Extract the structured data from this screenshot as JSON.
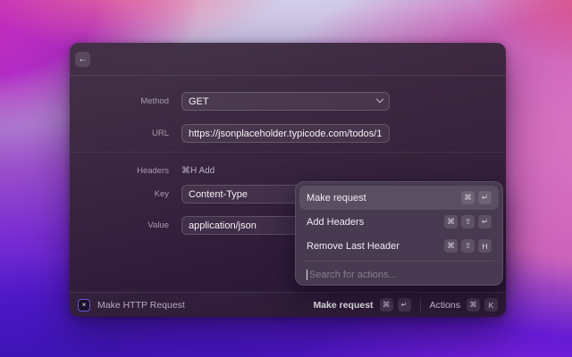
{
  "window": {
    "header": {
      "back_icon": "←"
    },
    "form": {
      "method": {
        "label": "Method",
        "value": "GET"
      },
      "url": {
        "label": "URL",
        "value": "https://jsonplaceholder.typicode.com/todos/1"
      },
      "headers": {
        "label": "Headers",
        "shortcut_hint": "⌘H Add"
      },
      "key": {
        "label": "Key",
        "value": "Content-Type"
      },
      "value": {
        "label": "Value",
        "value": "application/json"
      }
    },
    "statusbar": {
      "extension_icon": "×",
      "extension_name": "Make HTTP Request",
      "primary_action": {
        "label": "Make request",
        "keys": [
          "⌘",
          "↵"
        ]
      },
      "actions_button": {
        "label": "Actions",
        "keys": [
          "⌘",
          "K"
        ]
      }
    }
  },
  "actions_popup": {
    "items": [
      {
        "label": "Make request",
        "keys": [
          "⌘",
          "↵"
        ]
      },
      {
        "label": "Add Headers",
        "keys": [
          "⌘",
          "⇧",
          "↵"
        ]
      },
      {
        "label": "Remove Last Header",
        "keys": [
          "⌘",
          "⇧",
          "H"
        ]
      }
    ],
    "search_placeholder": "Search for actions..."
  },
  "colors": {
    "accent_border": "#6d55d8",
    "window_bg": "#38253c",
    "popup_bg": "#483b52",
    "selected_row": "rgba(255,255,255,0.10)"
  }
}
